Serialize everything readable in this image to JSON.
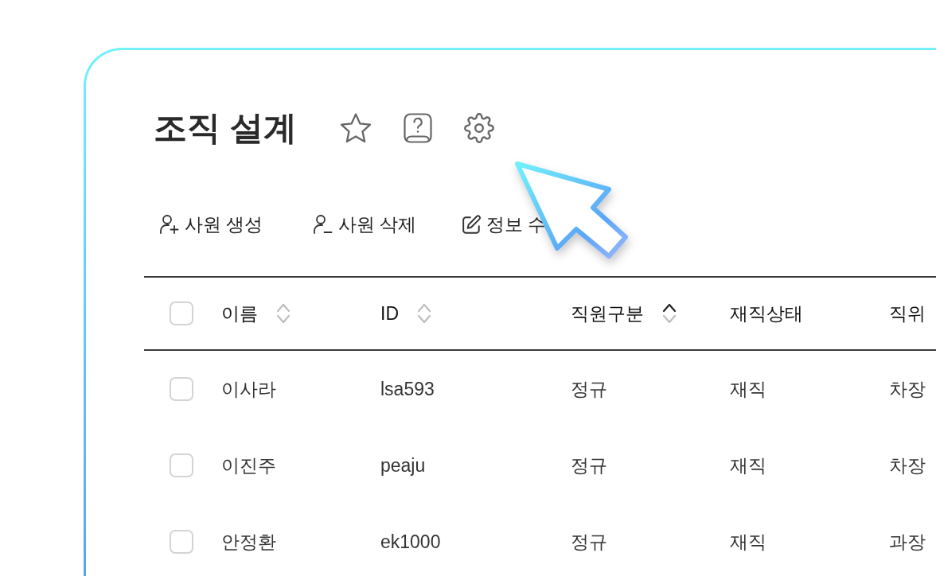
{
  "page": {
    "title": "조직 설계",
    "favorite": false
  },
  "toolbar": [
    {
      "kind": "add-user",
      "label": "사원 생성"
    },
    {
      "kind": "remove-user",
      "label": "사원 삭제"
    },
    {
      "kind": "edit",
      "label": "정보 수"
    }
  ],
  "table": {
    "select_all": {
      "checked": false
    },
    "columns": [
      {
        "label": "이름",
        "sortable": true,
        "sorted": false
      },
      {
        "label": "ID",
        "sortable": true,
        "sorted": false
      },
      {
        "label": "직원구분",
        "sortable": true,
        "sorted": true
      },
      {
        "label": "재직상태",
        "sortable": false
      },
      {
        "label": "직위",
        "sortable": false
      }
    ],
    "rows": [
      {
        "checked": false,
        "cells": [
          "이사라",
          "lsa593",
          "정규",
          "재직",
          "차장"
        ]
      },
      {
        "checked": false,
        "cells": [
          "이진주",
          "peaju",
          "정규",
          "재직",
          "차장"
        ]
      },
      {
        "checked": false,
        "cells": [
          "안정환",
          "ek1000",
          "정규",
          "재직",
          "과장"
        ]
      }
    ]
  }
}
